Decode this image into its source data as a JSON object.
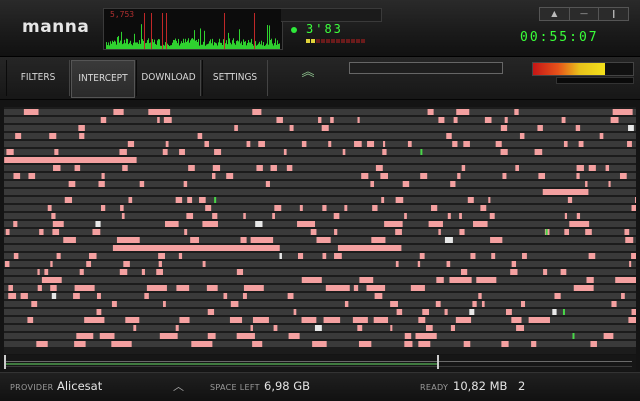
{
  "app": {
    "logo": "manna"
  },
  "header": {
    "spectrum_label": "5,753",
    "signal_value": "3'83",
    "clock": "00:55:07",
    "window_controls": [
      "▲",
      "—",
      "❙"
    ]
  },
  "toolbar": {
    "tabs": [
      {
        "label": "FILTERS"
      },
      {
        "label": "INTERCEPT",
        "active": true
      },
      {
        "label": "DOWNLOAD"
      },
      {
        "label": "SETTINGS"
      }
    ],
    "collapse_icon": "double-chevron-up-icon",
    "progress_slider_fraction": 0.0,
    "level_meter_fraction": 0.72
  },
  "status": {
    "provider_label": "PROVIDER",
    "provider_value": "Alicesat",
    "space_label": "SPACE LEFT",
    "space_value": "6,98 GB",
    "ready_label": "READY",
    "ready_value": "10,82 MB",
    "ready_count": "2"
  },
  "scroll": {
    "position_fraction": 0.69
  },
  "colors": {
    "accent_green": "#39ff39",
    "segment_pink": "#f4a0a0",
    "row_gray": "#3a3a3a",
    "marker_green": "#49d649"
  }
}
